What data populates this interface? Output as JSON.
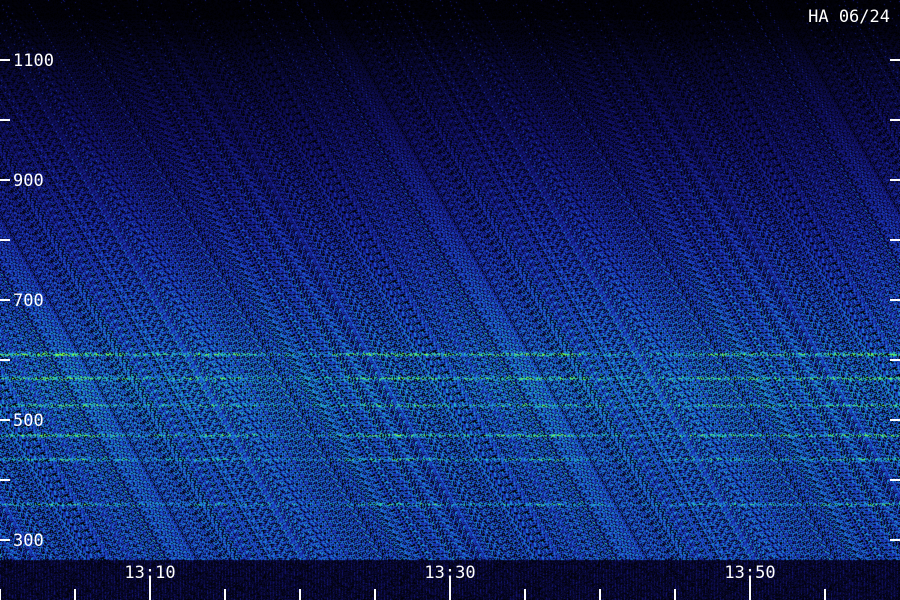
{
  "header": {
    "station_label": "HA 06/24"
  },
  "colors": {
    "background": "#000000",
    "low": "#1a1a8c",
    "mid": "#1e6fd0",
    "high": "#22c8b8",
    "peak": "#7cff3a",
    "tick": "#ffffff"
  },
  "chart_data": {
    "type": "heatmap",
    "title": "",
    "xlabel": "",
    "ylabel": "",
    "y_ticks_major": [
      {
        "value": 1100,
        "label": "1100"
      },
      {
        "value": 900,
        "label": "900"
      },
      {
        "value": 700,
        "label": "700"
      },
      {
        "value": 500,
        "label": "500"
      },
      {
        "value": 300,
        "label": "300"
      }
    ],
    "y_ticks_minor": [
      1000,
      800,
      600,
      400
    ],
    "x_ticks_major": [
      {
        "value": 10,
        "label": "13:10"
      },
      {
        "value": 30,
        "label": "13:30"
      },
      {
        "value": 50,
        "label": "13:50"
      }
    ],
    "x_ticks_minor": [
      0,
      5,
      15,
      20,
      25,
      35,
      40,
      45,
      55
    ],
    "xlim": [
      -5,
      55
    ],
    "ylim": [
      260,
      1200
    ],
    "intensity_bands": [
      {
        "freq": 1150,
        "level": 0.05
      },
      {
        "freq": 1100,
        "level": 0.12
      },
      {
        "freq": 1000,
        "level": 0.22
      },
      {
        "freq": 900,
        "level": 0.32
      },
      {
        "freq": 800,
        "level": 0.42
      },
      {
        "freq": 700,
        "level": 0.52
      },
      {
        "freq": 620,
        "level": 0.6
      },
      {
        "freq": 560,
        "level": 0.66
      },
      {
        "freq": 500,
        "level": 0.62
      },
      {
        "freq": 400,
        "level": 0.58
      },
      {
        "freq": 300,
        "level": 0.56
      }
    ],
    "emission_lines": [
      {
        "freq": 610,
        "level": 0.95
      },
      {
        "freq": 570,
        "level": 0.7
      },
      {
        "freq": 525,
        "level": 0.55
      },
      {
        "freq": 475,
        "level": 0.75
      },
      {
        "freq": 435,
        "level": 0.55
      },
      {
        "freq": 360,
        "level": 0.55
      }
    ]
  }
}
